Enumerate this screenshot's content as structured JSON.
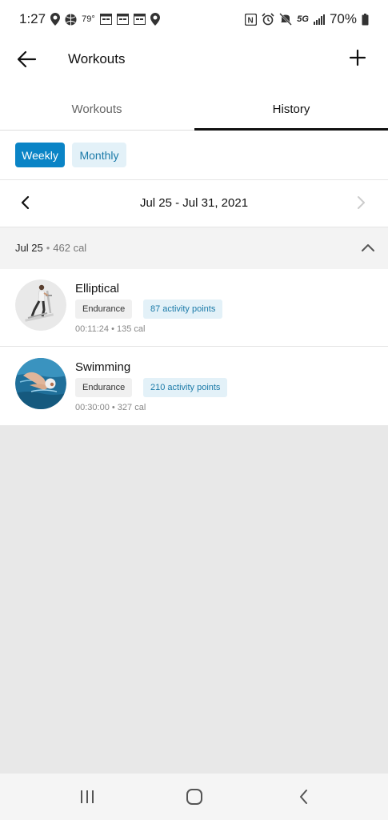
{
  "status_bar": {
    "time": "1:27",
    "temperature": "79°",
    "battery": "70%",
    "icons": [
      "location-icon",
      "sports-ball-icon",
      "calendar-icon",
      "calendar-icon",
      "calendar-icon",
      "location-icon",
      "nfc-icon",
      "alarm-icon",
      "mute-icon",
      "5g-icon",
      "signal-icon",
      "battery-icon"
    ],
    "network": "5G"
  },
  "app_bar": {
    "title": "Workouts",
    "back_icon": "back-arrow-icon",
    "add_icon": "plus-icon"
  },
  "tabs": [
    {
      "label": "Workouts",
      "selected": false
    },
    {
      "label": "History",
      "selected": true
    }
  ],
  "filter_chips": [
    {
      "label": "Weekly",
      "selected": true
    },
    {
      "label": "Monthly",
      "selected": false
    }
  ],
  "date_nav": {
    "range": "Jul 25 - Jul 31, 2021"
  },
  "day_group": {
    "date": "Jul 25",
    "calories": "462 cal",
    "expanded": true
  },
  "workouts": [
    {
      "name": "Elliptical",
      "tag": "Endurance",
      "points": "87 activity points",
      "duration": "00:11:24",
      "calories": "135 cal"
    },
    {
      "name": "Swimming",
      "tag": "Endurance",
      "points": "210 activity points",
      "duration": "00:30:00",
      "calories": "327 cal"
    }
  ],
  "colors": {
    "accent": "#0a84c6",
    "chip_light": "#e3f1f8",
    "chip_text": "#1b7aa8"
  }
}
